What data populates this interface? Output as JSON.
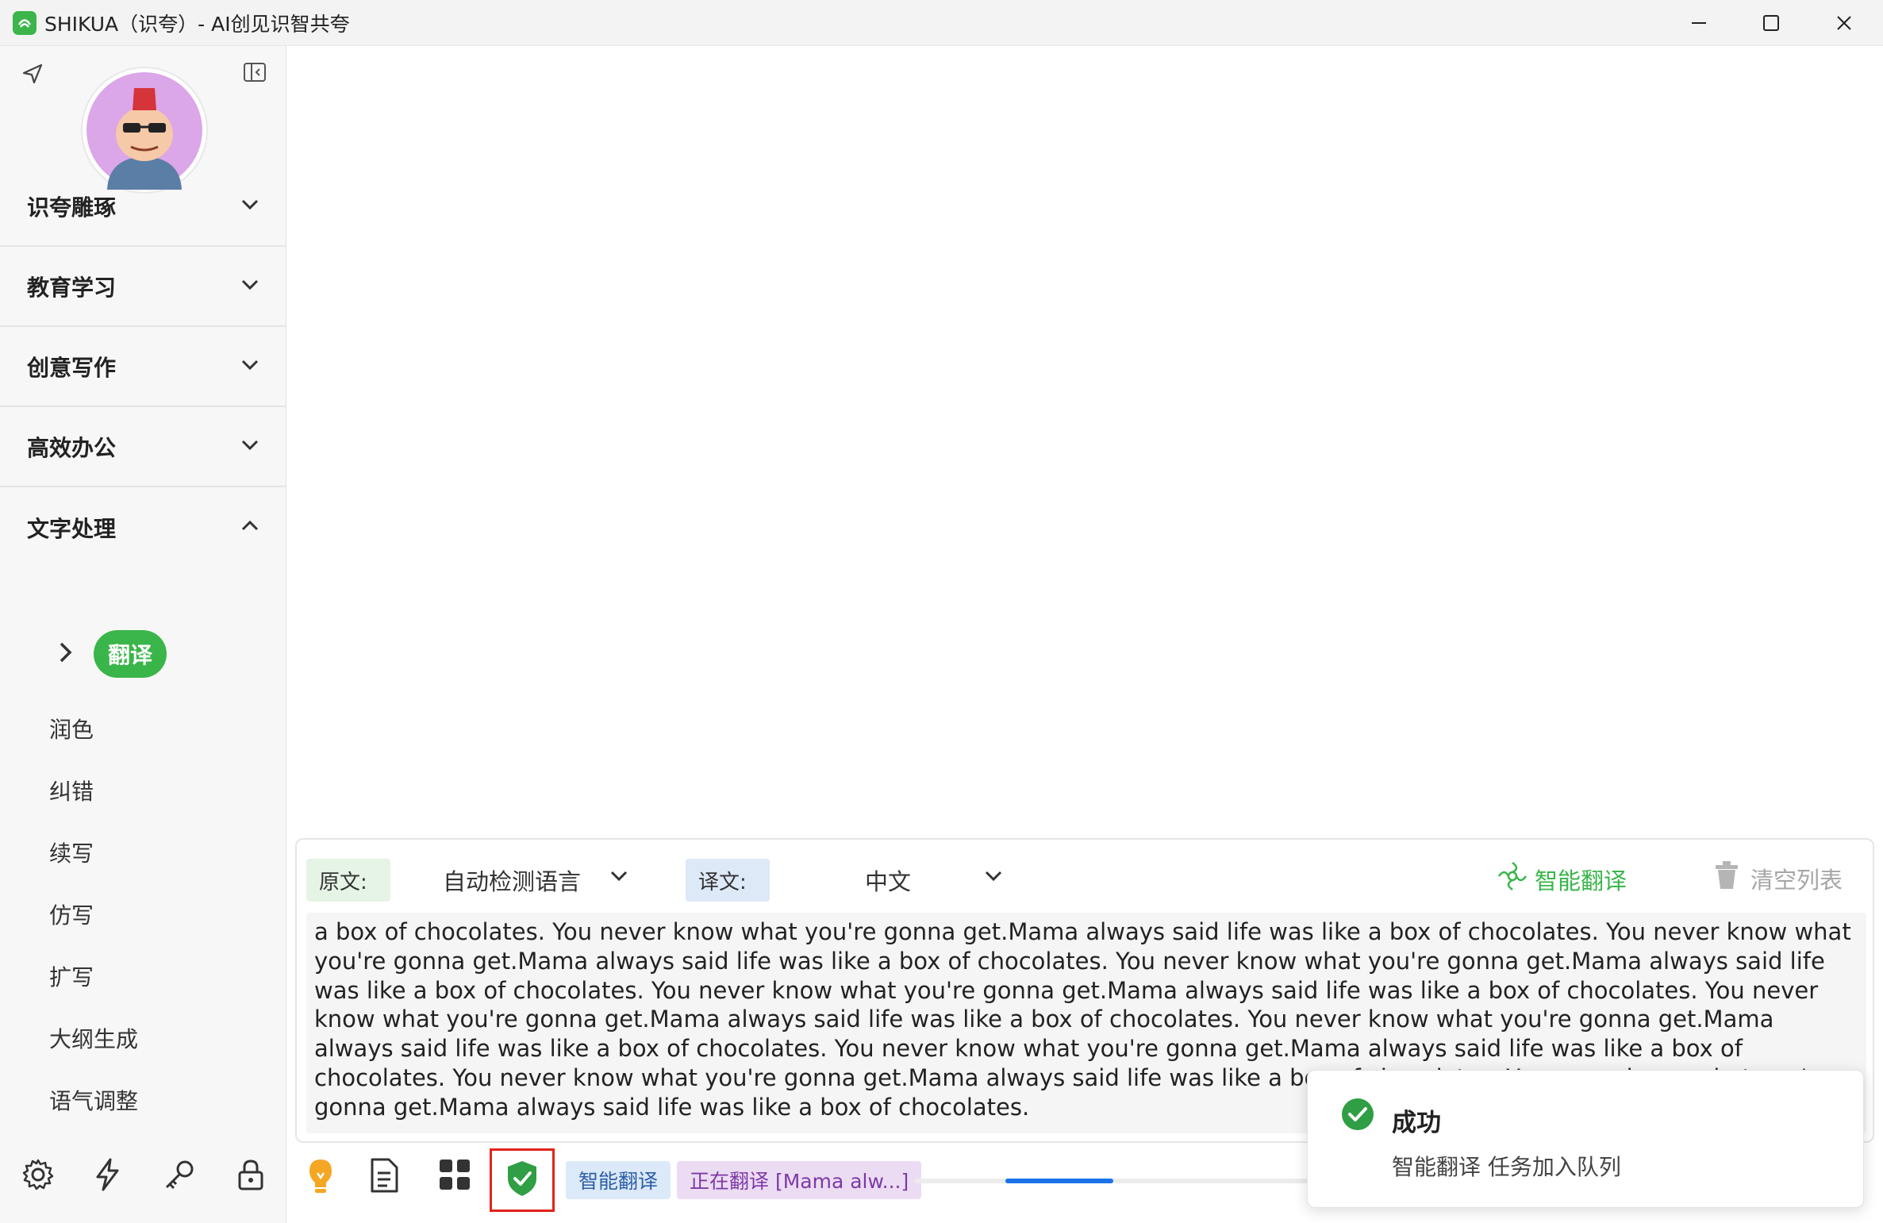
{
  "window": {
    "title": "SHIKUA（识夸）- AI创见识智共夸",
    "controls": {
      "minimize": "minimize",
      "maximize": "maximize",
      "close": "close"
    }
  },
  "sidebar": {
    "groups": [
      {
        "label": "识夸雕琢",
        "expanded": false
      },
      {
        "label": "教育学习",
        "expanded": false
      },
      {
        "label": "创意写作",
        "expanded": false
      },
      {
        "label": "高效办公",
        "expanded": false
      },
      {
        "label": "文字处理",
        "expanded": true
      }
    ],
    "active_item": "翻译",
    "items": [
      "润色",
      "纠错",
      "续写",
      "仿写",
      "扩写",
      "大纲生成",
      "语气调整"
    ]
  },
  "translator": {
    "source_tag": "原文:",
    "source_lang": "自动检测语言",
    "target_tag": "译文:",
    "target_lang": "中文",
    "translate_button": "智能翻译",
    "clear_button": "清空列表",
    "text": "a box of chocolates. You never know what you're gonna get.Mama always said life was like a box of chocolates. You never know what you're gonna get.Mama always said life was like a box of chocolates. You never know what you're gonna get.Mama always said life was like a box of chocolates. You never know what you're gonna get.Mama always said life was like a box of chocolates. You never know what you're gonna get.Mama always said life was like a box of chocolates. You never know what you're gonna get.Mama always said life was like a box of chocolates. You never know what you're gonna get.Mama always said life was like a box of chocolates. You never know what you're gonna get.Mama always said life was like a box of chocolates. You never know what you're gonna get.Mama always said life was like a box of chocolates."
  },
  "status_bar": {
    "chip_task": "智能翻译",
    "chip_progress": "正在翻译 [Mama alw...]",
    "progress_fraction": 0.26
  },
  "toast": {
    "title": "成功",
    "message": "智能翻译 任务加入队列"
  },
  "colors": {
    "brand_green": "#3ab54a",
    "progress_blue": "#1a73e8",
    "highlight_red": "#e2231a"
  },
  "icons": {
    "left_tools": [
      "gear-icon",
      "lightning-icon",
      "key-icon",
      "lock-icon"
    ],
    "toolbar": [
      "bulb-icon",
      "document-icon",
      "grid-icon",
      "shield-check-icon"
    ]
  }
}
